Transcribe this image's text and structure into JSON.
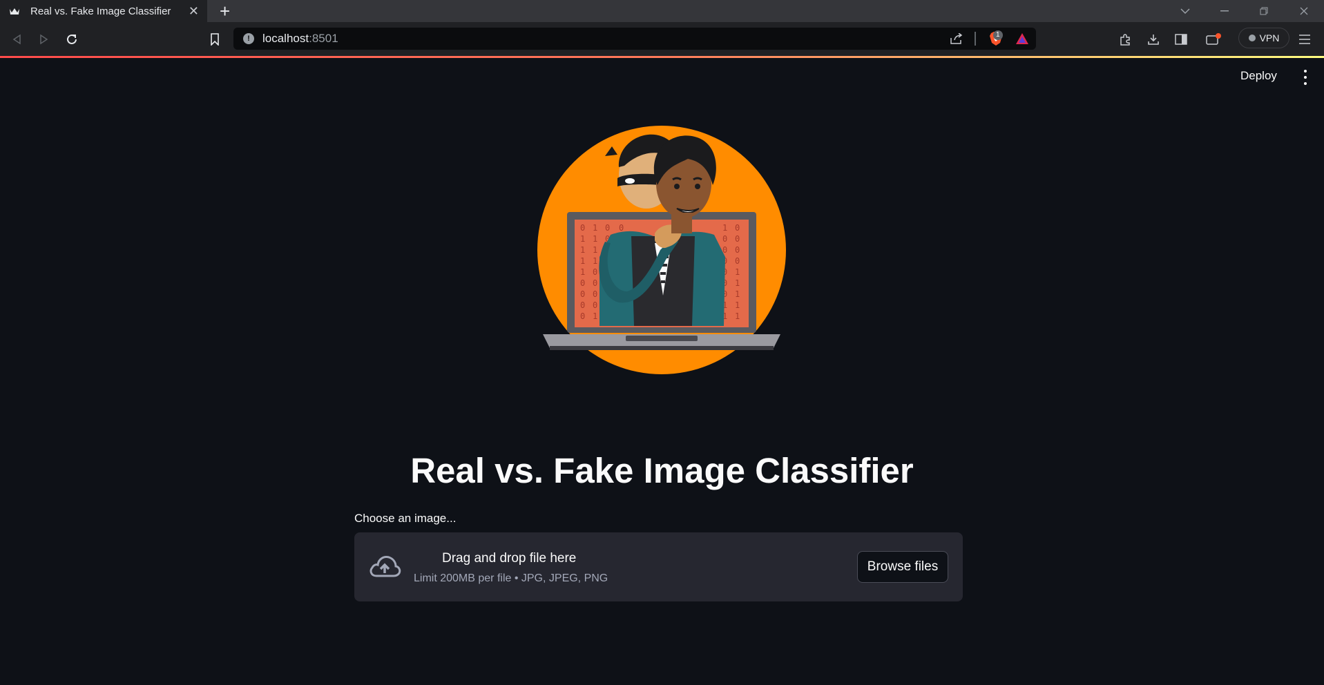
{
  "browser": {
    "tab_title": "Real vs. Fake Image Classifier",
    "tab_close": "✕",
    "new_tab": "+",
    "url_host": "localhost",
    "url_port": ":8501",
    "shield_badge": "1",
    "vpn_label": "VPN"
  },
  "app": {
    "deploy_label": "Deploy",
    "title": "Real vs. Fake Image Classifier",
    "hero_binary": [
      "0",
      "1",
      "0",
      "0",
      "1",
      "0",
      "1",
      "1",
      "0",
      "1",
      "0",
      "0",
      "1",
      "1",
      "0",
      "1",
      "0",
      "0",
      "1",
      "1"
    ],
    "uploader": {
      "label": "Choose an image...",
      "drop_text": "Drag and drop file here",
      "limit_text": "Limit 200MB per file • JPG, JPEG, PNG",
      "browse_label": "Browse files"
    }
  },
  "colors": {
    "background": "#0e1117",
    "dropzone": "#262730",
    "hero_circle": "#ff8c00",
    "laptop_screen": "#e46a4a",
    "shirt": "#236b73"
  }
}
